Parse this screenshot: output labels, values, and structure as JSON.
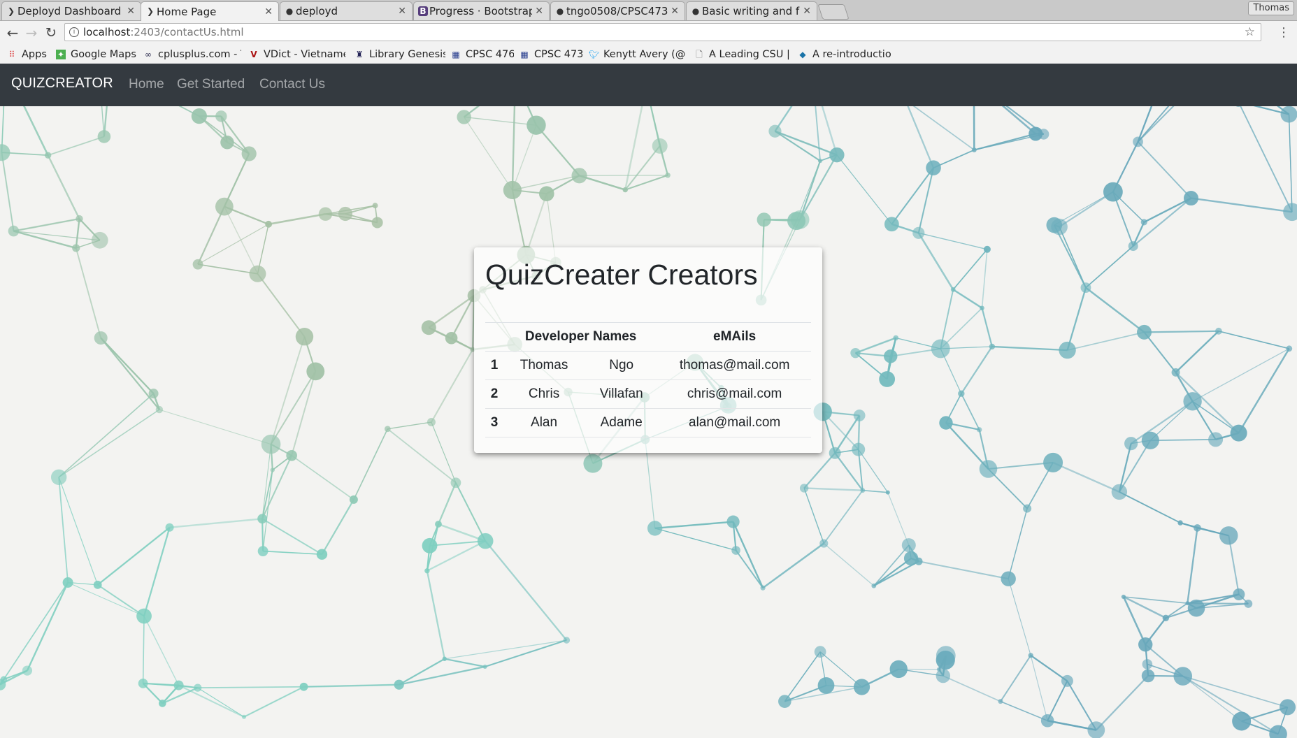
{
  "browser": {
    "tabs": [
      {
        "title": "Deployd Dashboard",
        "favicon": "deployd-icon",
        "active": false
      },
      {
        "title": "Home Page",
        "favicon": "deployd-icon",
        "active": true
      },
      {
        "title": "deployd",
        "favicon": "github-icon",
        "active": false
      },
      {
        "title": "Progress · Bootstrap",
        "favicon": "bootstrap-icon",
        "active": false
      },
      {
        "title": "tngo0508/CPSC473",
        "favicon": "github-icon",
        "active": false
      },
      {
        "title": "Basic writing and formatting",
        "favicon": "github-icon",
        "active": false
      }
    ],
    "profile": "Thomas",
    "url_host": "localhost",
    "url_path": ":2403/contactUs.html",
    "bookmarks": [
      {
        "label": "Apps",
        "icon": "apps-grid-icon"
      },
      {
        "label": "Google Maps",
        "icon": "maps-icon"
      },
      {
        "label": "cplusplus.com - T",
        "icon": "cplusplus-icon"
      },
      {
        "label": "VDict - Vietname",
        "icon": "vdict-icon"
      },
      {
        "label": "Library Genesis",
        "icon": "library-icon"
      },
      {
        "label": "CPSC 476",
        "icon": "course-icon"
      },
      {
        "label": "CPSC 473",
        "icon": "course-icon"
      },
      {
        "label": "Kenytt Avery (@",
        "icon": "twitter-icon"
      },
      {
        "label": "A Leading CSU | C",
        "icon": "page-icon"
      },
      {
        "label": "A re-introductio",
        "icon": "mdn-icon"
      }
    ]
  },
  "site": {
    "brand": "QUIZCREATOR",
    "nav": [
      "Home",
      "Get Started",
      "Contact Us"
    ]
  },
  "card": {
    "title": "QuizCreater Creators",
    "headers": [
      "Developer Names",
      "eMAils"
    ],
    "rows": [
      {
        "idx": "1",
        "first": "Thomas",
        "last": "Ngo",
        "email": "thomas@mail.com"
      },
      {
        "idx": "2",
        "first": "Chris",
        "last": "Villafan",
        "email": "chris@mail.com"
      },
      {
        "idx": "3",
        "first": "Alan",
        "last": "Adame",
        "email": "alan@mail.com"
      }
    ]
  },
  "colors": {
    "navbar": "#343a40",
    "network_teal": "#7fcfc0",
    "network_blue": "#5a8fb8",
    "network_tan": "#c2b48f"
  }
}
